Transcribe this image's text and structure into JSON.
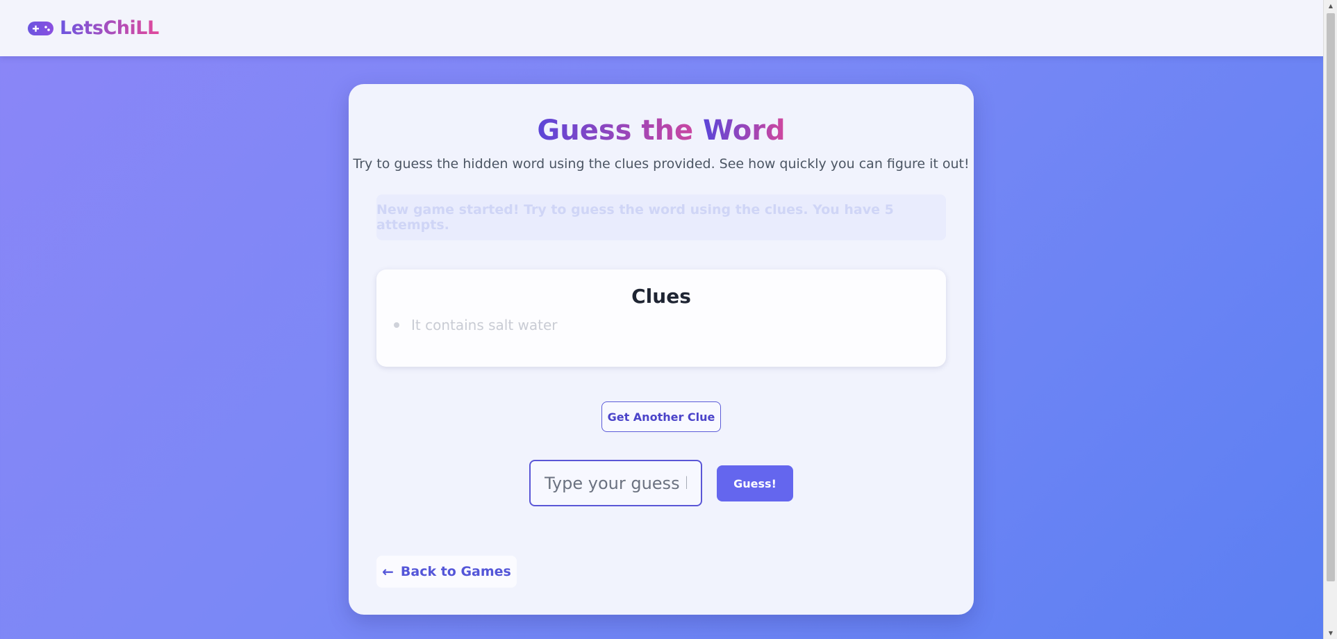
{
  "brand": {
    "name": "LetsChiLL",
    "icon": "gamepad-icon"
  },
  "game": {
    "title_part1": "Guess the ",
    "title_part2": "Word",
    "subtitle": "Try to guess the hidden word using the clues provided. See how quickly you can figure it out!",
    "message": "New game started! Try to guess the word using the clues. You have 5 attempts."
  },
  "clues": {
    "title": "Clues",
    "items": [
      "It contains salt water"
    ]
  },
  "actions": {
    "another_clue_label": "Get Another Clue",
    "guess_placeholder": "Type your guess here",
    "guess_label": "Guess!",
    "back_label": "Back to Games",
    "back_icon": "arrow-left-icon"
  },
  "colors": {
    "accent": "#6466ee",
    "title_start": "#5b45d8",
    "title_end": "#d0479e",
    "background_start": "#8b86f7",
    "background_end": "#5b7ff2"
  }
}
